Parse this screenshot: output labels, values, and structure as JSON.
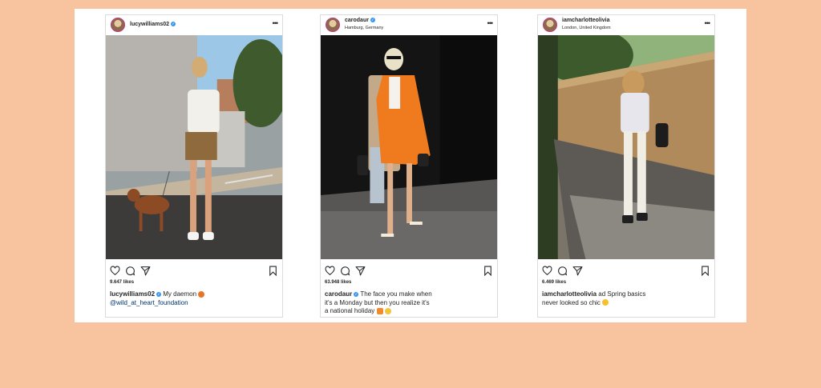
{
  "posts": [
    {
      "username": "lucywilliams02",
      "location": "",
      "likes": "9.647 likes",
      "caption_user": "lucywilliams02",
      "caption_text": " My daemon ",
      "caption_mention": "@wild_at_heart_foundation",
      "caption_line2": "",
      "caption_line3": "",
      "emoji": [
        "fox-emoji"
      ]
    },
    {
      "username": "carodaur",
      "location": "Hamburg, Germany",
      "likes": "63.948 likes",
      "caption_user": "carodaur",
      "caption_text": " The face you make when",
      "caption_mention": "",
      "caption_line2": "it's a Monday but then you realize it's",
      "caption_line3": "a national holiday ",
      "emoji": [
        "orange-heart-emoji",
        "grimacing-face-emoji"
      ]
    },
    {
      "username": "iamcharlotteolivia",
      "location": "London, United Kingdom",
      "likes": "6.469 likes",
      "caption_user": "iamcharlotteolivia",
      "caption_text": " ad Spring basics",
      "caption_mention": "",
      "caption_line2": "never looked so chic ",
      "caption_line3": "",
      "emoji": [
        "sun-emoji"
      ]
    }
  ],
  "icons": [
    "verified-badge-icon",
    "more-options-icon",
    "like-heart-icon",
    "comment-icon",
    "share-icon",
    "bookmark-icon"
  ],
  "colors": {
    "background": "#f8c39f",
    "board": "#ffffff",
    "verified": "#3897f0",
    "text": "#262626"
  }
}
